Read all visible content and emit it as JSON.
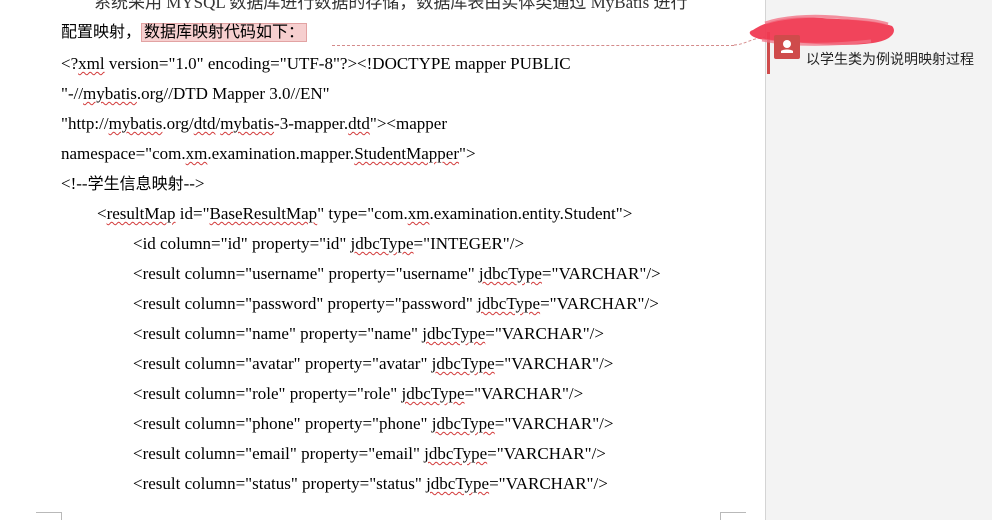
{
  "document": {
    "cut_line": "系统采用 MYSQL 数据库进行数据的存储，数据库表由实体类通过 MyBatis 进行",
    "intro_prefix": "配置映射，",
    "intro_commented": "数据库映射代码如下：",
    "code_lines": [
      "<?xml version=\"1.0\" encoding=\"UTF-8\"?><!DOCTYPE mapper PUBLIC",
      "\"-//mybatis.org//DTD Mapper 3.0//EN\"",
      "\"http://mybatis.org/dtd/mybatis-3-mapper.dtd\"><mapper",
      "namespace=\"com.xm.examination.mapper.StudentMapper\">",
      "<!--学生信息映射-->",
      "<resultMap id=\"BaseResultMap\" type=\"com.xm.examination.entity.Student\">",
      "<id column=\"id\" property=\"id\" jdbcType=\"INTEGER\"/>",
      "<result column=\"username\" property=\"username\" jdbcType=\"VARCHAR\"/>",
      "<result column=\"password\" property=\"password\" jdbcType=\"VARCHAR\"/>",
      "<result column=\"name\" property=\"name\" jdbcType=\"VARCHAR\"/>",
      "<result column=\"avatar\" property=\"avatar\" jdbcType=\"VARCHAR\"/>",
      "<result column=\"role\" property=\"role\" jdbcType=\"VARCHAR\"/>",
      "<result column=\"phone\" property=\"phone\" jdbcType=\"VARCHAR\"/>",
      "<result column=\"email\" property=\"email\" jdbcType=\"VARCHAR\"/>",
      "<result column=\"status\" property=\"status\" jdbcType=\"VARCHAR\"/>"
    ],
    "squiggle_words": [
      "xml",
      "mybatis",
      "dtd",
      "StudentMapper",
      "xm",
      "resultMap",
      "BaseResultMap",
      "jdbcType"
    ]
  },
  "comment": {
    "text": "以学生类为例说明映射过程",
    "accent_color": "#cf4b4b",
    "redaction_color": "#f03a52",
    "avatar_icon": "user-avatar-icon"
  }
}
